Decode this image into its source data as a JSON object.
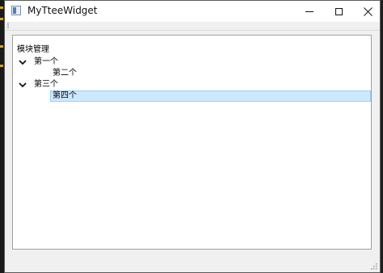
{
  "window": {
    "title": "MyTteeWidget"
  },
  "tree": {
    "header": "模块管理",
    "items": [
      {
        "label": "第一个",
        "expanded": true,
        "level": 0
      },
      {
        "label": "第二个",
        "level": 1
      },
      {
        "label": "第三个",
        "expanded": true,
        "level": 0
      },
      {
        "label": "第四个",
        "level": 1,
        "selected": true
      }
    ]
  },
  "colors": {
    "selection_fill": "#cce8ff",
    "selection_border": "#99d1ff",
    "titlebar": "#ffffff",
    "window_bg": "#f0f0f0"
  },
  "icons": {
    "app": "window-app-icon",
    "minimize": "minimize-icon",
    "maximize": "maximize-icon",
    "close": "close-icon",
    "expand": "chevron-down-icon",
    "resize": "size-grip-icon"
  }
}
